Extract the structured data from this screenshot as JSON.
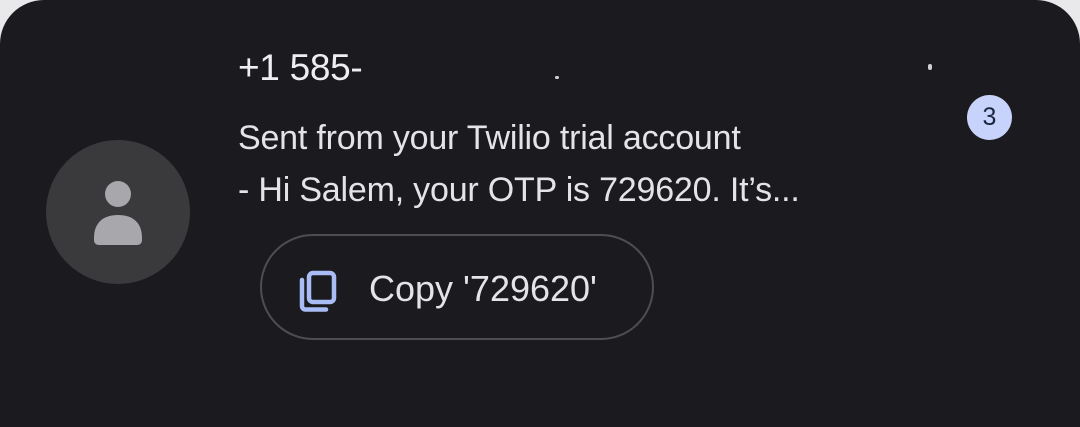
{
  "conversation": {
    "sender": "+1 585-",
    "snippet_line1": "Sent from your Twilio trial account",
    "snippet_line2": "- Hi Salem, your OTP is 729620. It’s...",
    "unread_count": "3"
  },
  "copy_chip": {
    "label": "Copy '729620'"
  },
  "icons": {
    "avatar": "person-icon",
    "copy": "copy-icon"
  },
  "colors": {
    "background": "#1b1b1f",
    "avatar_bg": "#3a3a3d",
    "badge_bg": "#c7d3fb",
    "copy_icon": "#a9bcf5"
  }
}
